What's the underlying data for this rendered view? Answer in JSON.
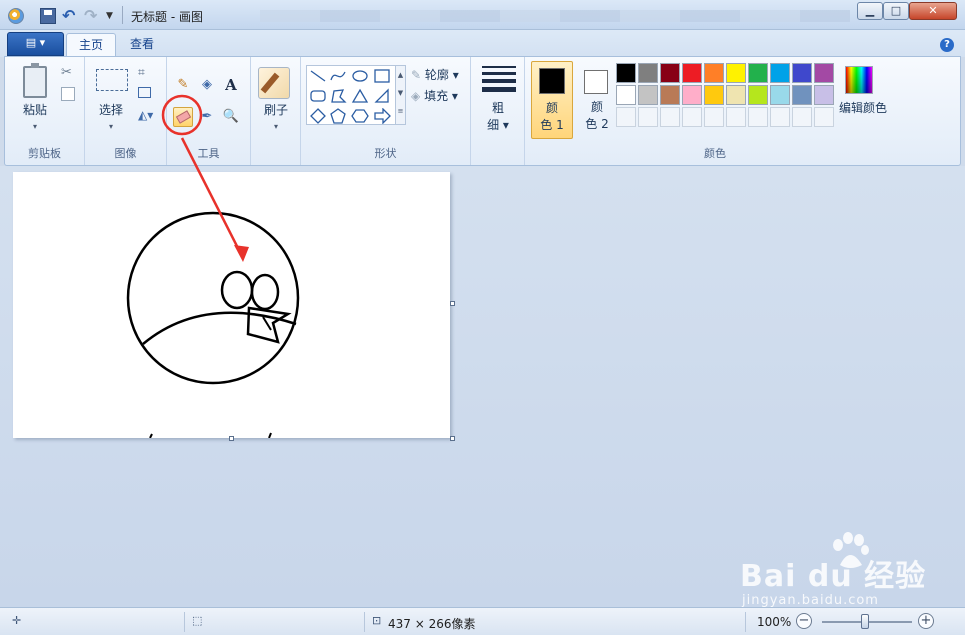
{
  "window": {
    "title": "无标题 - 画图",
    "min_label": "▁",
    "max_label": "□",
    "close_label": "✕"
  },
  "qat": {
    "undo": "↶",
    "redo": "↷",
    "dropdown": "▼"
  },
  "tabs": {
    "file": "▤ ▾",
    "home": "主页",
    "view": "查看",
    "help": "?"
  },
  "ribbon": {
    "clipboard": {
      "label": "剪贴板",
      "paste": "粘贴",
      "paste_arrow": "▾"
    },
    "image": {
      "label": "图像",
      "select": "选择",
      "select_arrow": "▾",
      "crop_glyph": "⌗",
      "rotate_glyph": "◭▾"
    },
    "tools": {
      "label": "工具",
      "pencil": "✎",
      "fill": "◈",
      "text": "A",
      "picker": "✒",
      "magnifier": "🔍"
    },
    "brushes": {
      "label": "刷子",
      "arrow": "▾"
    },
    "shapes": {
      "label": "形状",
      "outline": "轮廓 ▾",
      "fill": "填充 ▾",
      "scroll_up": "▲",
      "scroll_down": "▼",
      "scroll_more": "≡"
    },
    "size": {
      "label1": "粗",
      "label2": "细 ▾"
    },
    "colors": {
      "label": "颜色",
      "color1_label1": "颜",
      "color1_label2": "色 1",
      "color2_label1": "颜",
      "color2_label2": "色 2",
      "edit_colors": "编辑颜色",
      "color1": "#000000",
      "color2": "#ffffff",
      "palette_row1": [
        "#000000",
        "#7f7f7f",
        "#880015",
        "#ed1c24",
        "#ff7f27",
        "#fff200",
        "#22b14c",
        "#00a2e8",
        "#3f48cc",
        "#a349a4"
      ],
      "palette_row2": [
        "#ffffff",
        "#c3c3c3",
        "#b97a57",
        "#ffaec9",
        "#ffc90e",
        "#efe4b0",
        "#b5e61d",
        "#99d9ea",
        "#7092be",
        "#c8bfe7"
      ]
    }
  },
  "status": {
    "cursor_icon": "✛",
    "selection_icon": "⬚",
    "canvas_size_icon": "⊡",
    "canvas_size": "437 × 266像素",
    "zoom": "100%",
    "zoom_out": "−",
    "zoom_in": "+",
    "zoom_level": 0.48
  },
  "annotation": {
    "color": "#e8322b"
  },
  "watermark": {
    "main": "Bai du 经验",
    "sub": "jingyan.baidu.com"
  }
}
